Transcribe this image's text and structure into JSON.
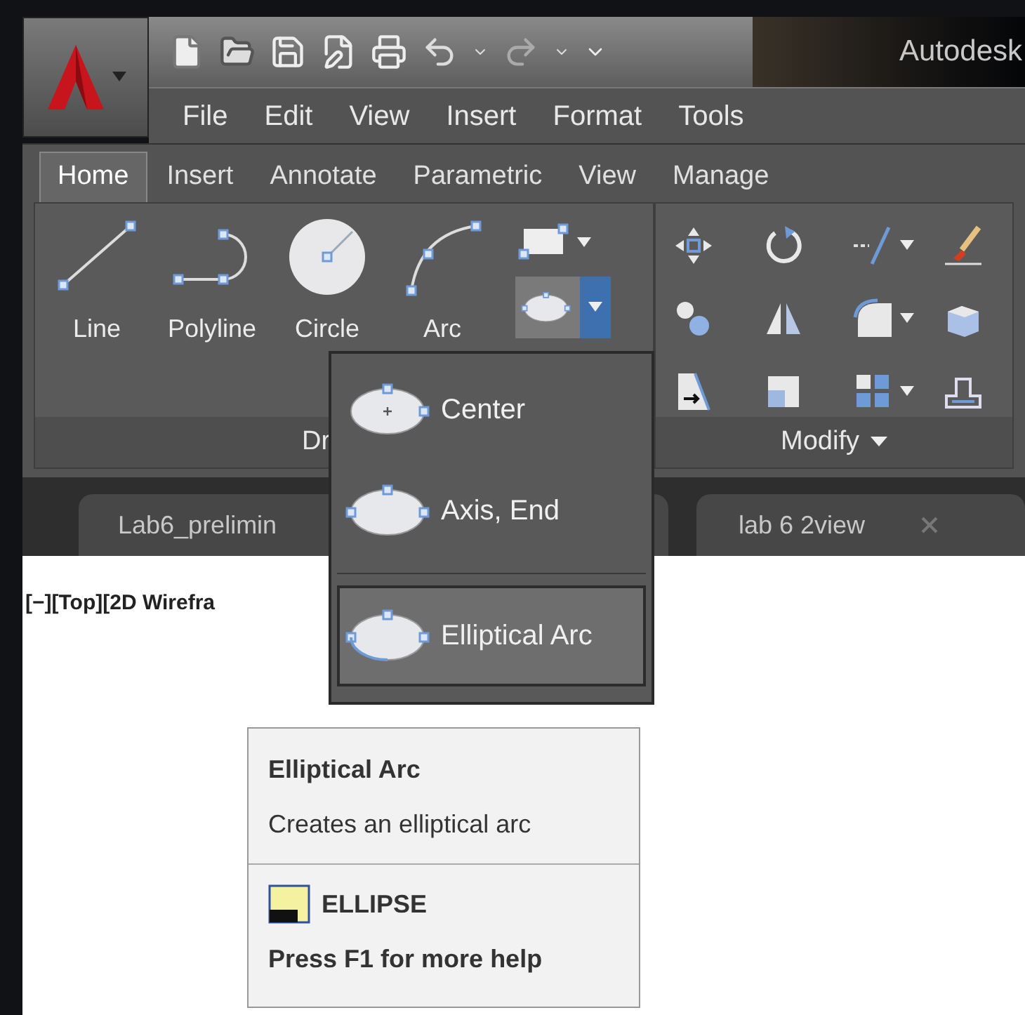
{
  "window": {
    "title": "Autodesk"
  },
  "menu_bar": [
    "File",
    "Edit",
    "View",
    "Insert",
    "Format",
    "Tools"
  ],
  "ribbon_tabs": [
    {
      "label": "Home",
      "selected": true
    },
    {
      "label": "Insert",
      "selected": false
    },
    {
      "label": "Annotate",
      "selected": false
    },
    {
      "label": "Parametric",
      "selected": false
    },
    {
      "label": "View",
      "selected": false
    },
    {
      "label": "Manage",
      "selected": false
    }
  ],
  "draw_panel": {
    "title": "Dr",
    "tools": [
      {
        "kind": "line",
        "label": "Line"
      },
      {
        "kind": "polyline",
        "label": "Polyline"
      },
      {
        "kind": "circle",
        "label": "Circle"
      },
      {
        "kind": "arc",
        "label": "Arc"
      }
    ]
  },
  "modify_panel": {
    "title": "Modify",
    "tools": [
      {
        "kind": "move",
        "dropdown": false
      },
      {
        "kind": "rotate",
        "dropdown": false
      },
      {
        "kind": "trim",
        "dropdown": true
      },
      {
        "kind": "brush",
        "dropdown": false
      },
      {
        "kind": "copy",
        "dropdown": false
      },
      {
        "kind": "mirror",
        "dropdown": false
      },
      {
        "kind": "fillet",
        "dropdown": true
      },
      {
        "kind": "cube",
        "dropdown": false
      },
      {
        "kind": "stretch",
        "dropdown": false
      },
      {
        "kind": "scale",
        "dropdown": false
      },
      {
        "kind": "array",
        "dropdown": true
      },
      {
        "kind": "offset",
        "dropdown": false
      }
    ]
  },
  "file_tabs": [
    {
      "label": "Lab6_prelimin",
      "selected": false
    },
    {
      "label": "lab 6 2view",
      "selected": false
    }
  ],
  "viewport_label": "[−][Top][2D Wirefra",
  "ellipse_menu": {
    "items": [
      {
        "kind": "center",
        "label": "Center",
        "selected": false
      },
      {
        "kind": "axis",
        "label": "Axis, End",
        "selected": false
      },
      {
        "kind": "arc",
        "label": "Elliptical Arc",
        "selected": true
      }
    ]
  },
  "tooltip": {
    "title": "Elliptical Arc",
    "description": "Creates an elliptical arc",
    "command": "ELLIPSE",
    "help": "Press F1 for more help"
  }
}
